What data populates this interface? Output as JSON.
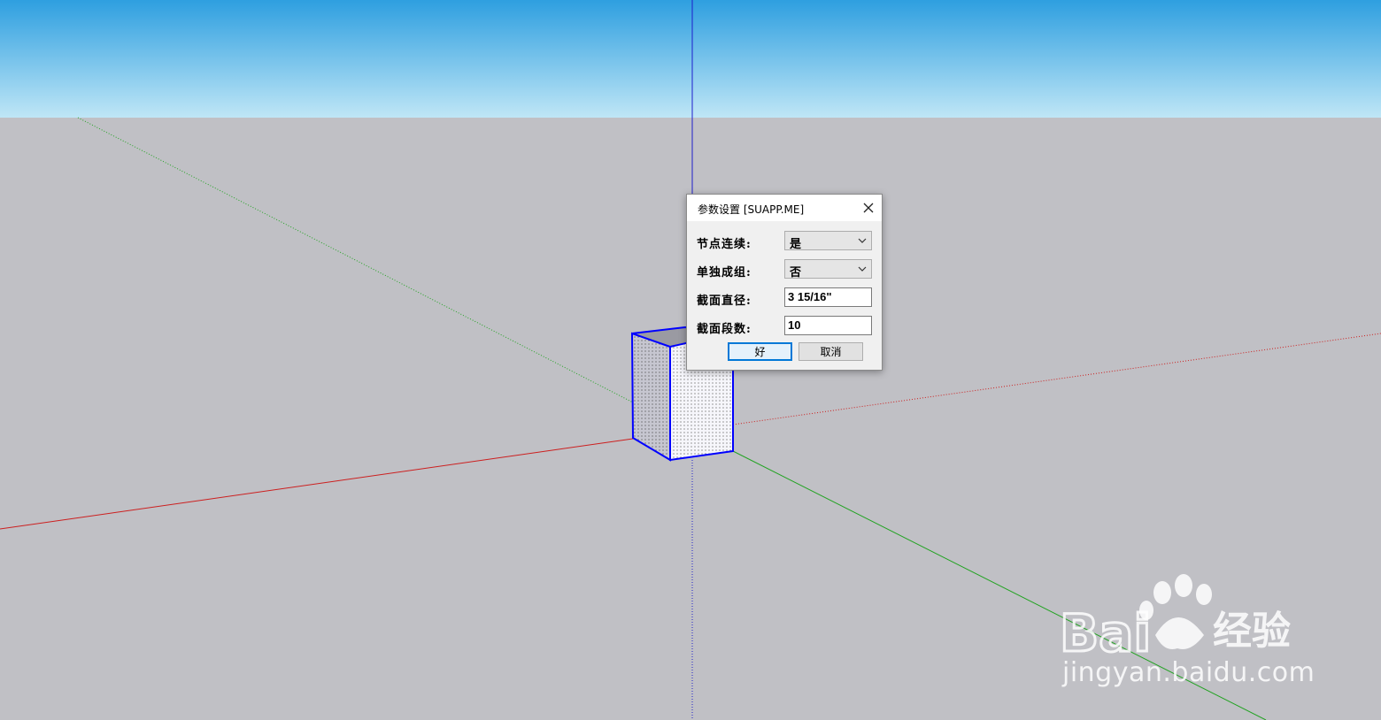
{
  "dialog": {
    "title": "参数设置 [SUAPP.ME]",
    "fields": [
      {
        "label": "节点连续:",
        "type": "select",
        "value": "是"
      },
      {
        "label": "单独成组:",
        "type": "select",
        "value": "否"
      },
      {
        "label": "截面直径:",
        "type": "input",
        "value": "3 15/16\""
      },
      {
        "label": "截面段数:",
        "type": "input",
        "value": "10"
      }
    ],
    "ok_label": "好",
    "cancel_label": "取消"
  },
  "watermark": {
    "brand": "Baidu经验",
    "url": "jingyan.baidu.com"
  },
  "colors": {
    "sky_top": "#2e9fe0",
    "sky_bottom": "#bfe6f6",
    "ground": "#c0c0c5",
    "red_axis": "#cc1f1f",
    "green_axis": "#23a323",
    "blue_axis": "#1f1fcc",
    "selection": "#0000ff"
  }
}
